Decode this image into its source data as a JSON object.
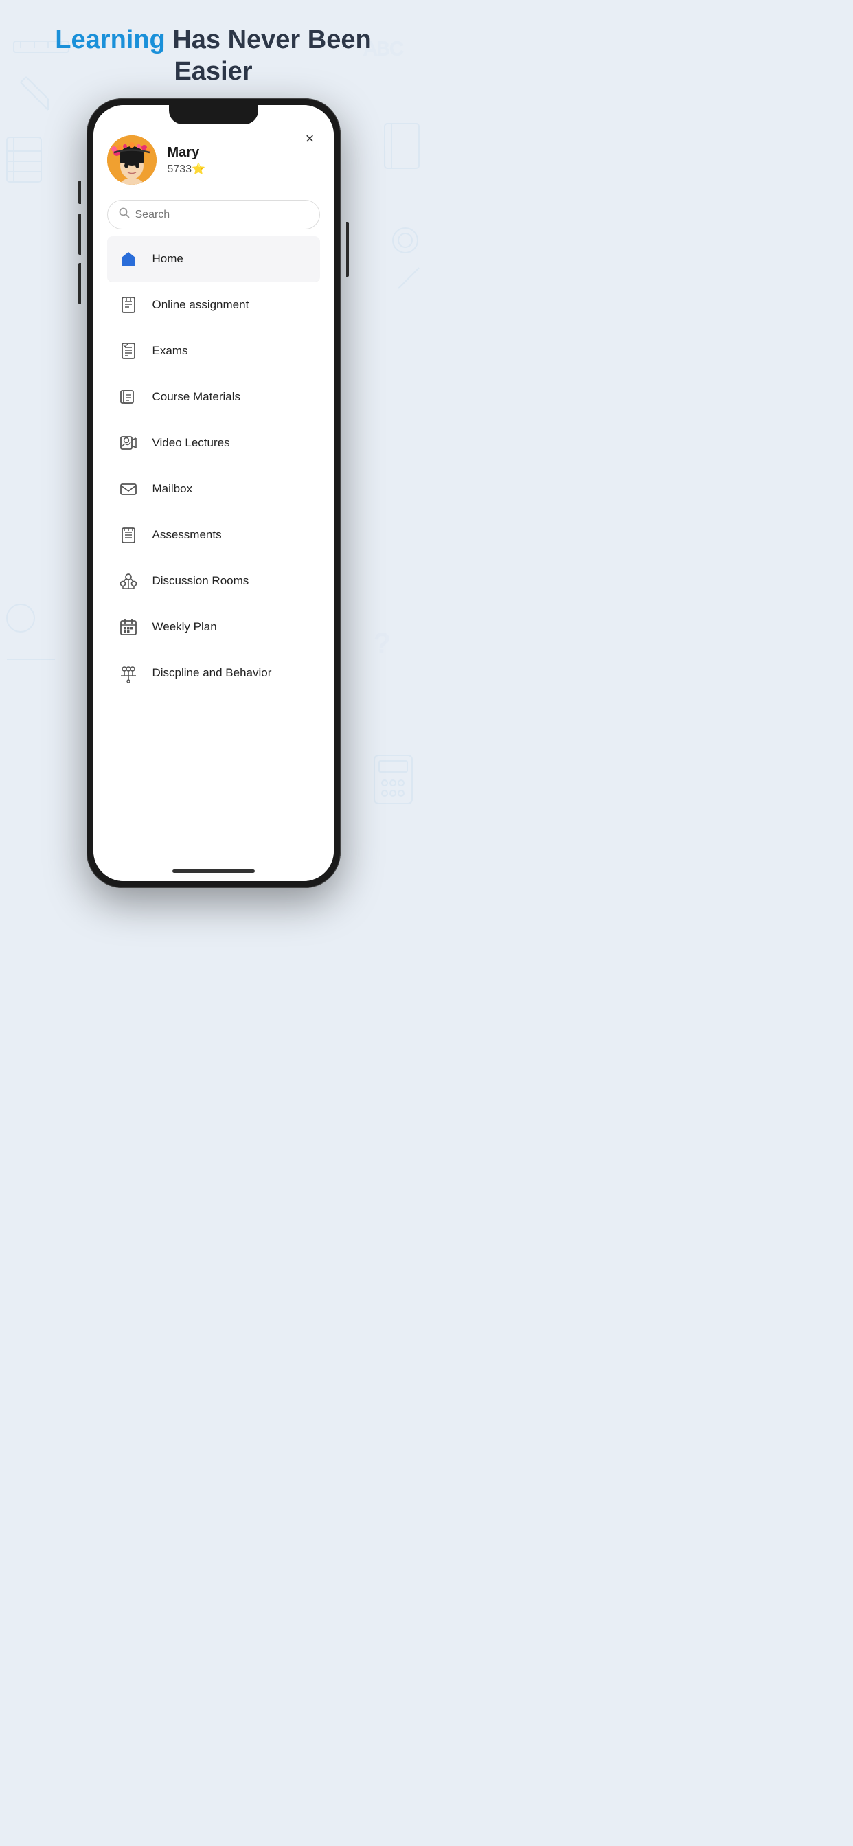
{
  "page": {
    "title_blue": "Learning",
    "title_rest": " Has Never Been Easier"
  },
  "profile": {
    "name": "Mary",
    "stars_count": "5733",
    "star_emoji": "⭐"
  },
  "search": {
    "placeholder": "Search"
  },
  "close_label": "×",
  "menu_items": [
    {
      "id": "home",
      "label": "Home",
      "icon": "home"
    },
    {
      "id": "online-assign",
      "label": "Online assignment",
      "icon": "assignment"
    },
    {
      "id": "exams",
      "label": "Exams",
      "icon": "exams"
    },
    {
      "id": "course-mat",
      "label": "Course Materials",
      "icon": "materials"
    },
    {
      "id": "video-lec",
      "label": "Video Lectures",
      "icon": "video"
    },
    {
      "id": "mailbox",
      "label": "Mailbox",
      "icon": "mail"
    },
    {
      "id": "assessments",
      "label": "Assessments",
      "icon": "assess"
    },
    {
      "id": "discussion",
      "label": "Discussion Rooms",
      "icon": "discussion"
    },
    {
      "id": "weekly-plan",
      "label": "Weekly Plan",
      "icon": "calendar"
    },
    {
      "id": "discipline",
      "label": "Discpline and Behavior",
      "icon": "discipline"
    }
  ]
}
